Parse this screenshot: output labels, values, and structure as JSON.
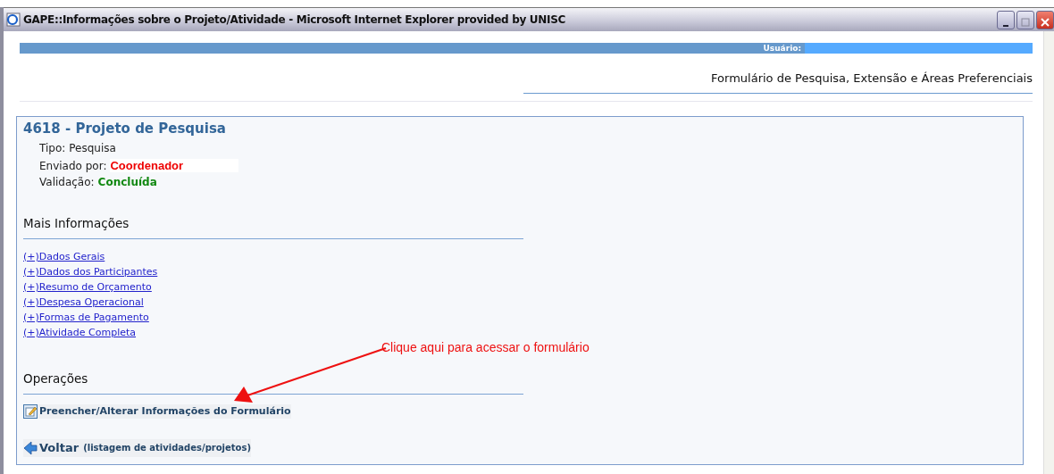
{
  "window": {
    "title": "GAPE::Informações sobre o Projeto/Atividade - Microsoft Internet Explorer provided by UNISC"
  },
  "user_bar": {
    "label": "Usuário:"
  },
  "page_heading": "Formulário de Pesquisa, Extensão e Áreas Preferenciais",
  "project": {
    "title": "4618 - Projeto de Pesquisa",
    "fields": [
      {
        "label": "Tipo:",
        "value": "Pesquisa",
        "kind": "plain"
      },
      {
        "label": "Enviado por:",
        "value": "Coordenador",
        "kind": "alert"
      },
      {
        "label": "Validação:",
        "value": "Concluída",
        "kind": "success"
      }
    ]
  },
  "more_info": {
    "heading": "Mais Informações",
    "links": [
      "(+)Dados Gerais",
      "(+)Dados dos Participantes",
      "(+)Resumo de Orçamento",
      "(+)Despesa Operacional",
      "(+)Formas de Pagamento",
      "(+)Atividade Completa"
    ]
  },
  "operations": {
    "heading": "Operações",
    "fill_link": "Preencher/Alterar Informações do Formulário",
    "back_link": {
      "label": "Voltar",
      "note": "(listagem de atividades/projetos)"
    }
  },
  "annotation": "Clique aqui para acessar o formulário"
}
